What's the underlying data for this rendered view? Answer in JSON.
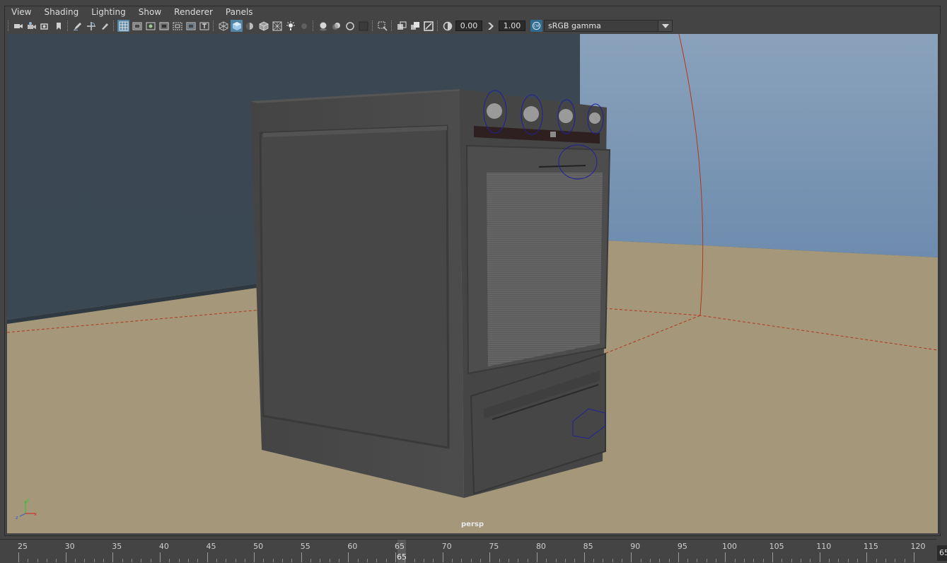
{
  "menubar": {
    "items": [
      {
        "label": "View"
      },
      {
        "label": "Shading"
      },
      {
        "label": "Lighting"
      },
      {
        "label": "Show"
      },
      {
        "label": "Renderer"
      },
      {
        "label": "Panels"
      }
    ]
  },
  "toolbar": {
    "exposure_value": "0.00",
    "gamma_value": "1.00",
    "color_space": "sRGB gamma",
    "icons": [
      "select-camera-icon",
      "camera-attributes-icon",
      "bookmarks-icon",
      "image-plane-icon",
      "grease-pencil-icon",
      "2d-pan-zoom-icon",
      "grid-icon",
      "film-gate-icon",
      "resolution-gate-icon",
      "gate-mask-icon",
      "field-chart-icon",
      "safe-action-icon",
      "safe-title-icon",
      "wireframe-icon",
      "smooth-shade-icon",
      "default-lighting-icon",
      "wireframe-on-shaded-icon",
      "xray-icon",
      "use-lights-icon",
      "shadows-icon",
      "screen-space-ambient-occlusion-icon",
      "motion-blur-icon",
      "anti-aliasing-icon",
      "depth-of-field-icon",
      "isolate-select-icon",
      "xray-joints-icon",
      "xray-active-icon",
      "backface-culling-icon",
      "exposure-icon",
      "gamma-icon",
      "color-management-icon"
    ]
  },
  "viewport": {
    "camera_label": "persp",
    "colors": {
      "wall_dark": "#3c4a55",
      "sky_light": "#7d98b5",
      "floor": "#a4977a",
      "stove_body": "#4a4a4a",
      "selection_outline": "#1a1a80",
      "light_locator": "#c03010"
    },
    "axis_labels": {
      "x": "x",
      "y": "y",
      "z": "z"
    }
  },
  "timeline": {
    "ticks": [
      "25",
      "30",
      "35",
      "40",
      "45",
      "50",
      "55",
      "60",
      "65",
      "70",
      "75",
      "80",
      "85",
      "90",
      "95",
      "100",
      "105",
      "110",
      "115",
      "120"
    ],
    "current_frame": "65",
    "end_frame_readout": "65"
  }
}
